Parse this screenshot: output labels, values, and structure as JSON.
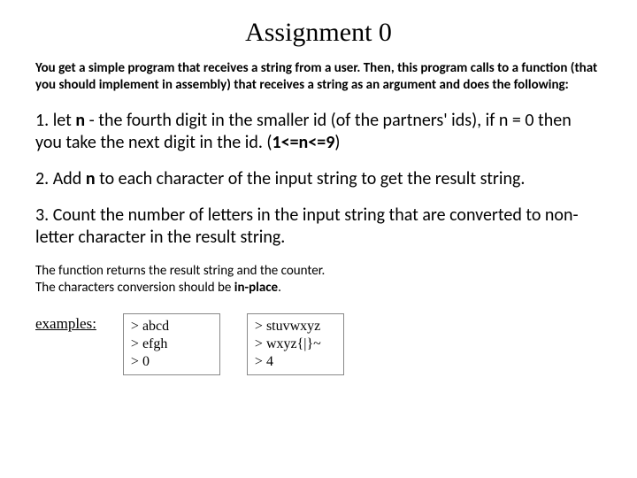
{
  "title": "Assignment 0",
  "intro": "You get a simple program that receives a string from a user. Then, this program calls to a function (that you should implement in assembly) that receives a string as an argument and does the following:",
  "step1_pre": "1. let ",
  "step1_n": "n",
  "step1_mid": " - the fourth digit in the smaller id (of the partners' ids), if n = 0 then you take the next digit in the id. (",
  "step1_range": "1<=n<=9",
  "step1_post": ")",
  "step2_pre": "2. Add ",
  "step2_n": "n",
  "step2_post": " to each character of the input string to get the result string.",
  "step3": "3. Count the number of letters in the input string that are converted to non-letter character in the result string.",
  "foot_line1": "The function returns the result string and the counter.",
  "foot_line2_pre": "The characters conversion should be ",
  "foot_line2_bold": "in-place",
  "foot_line2_post": ".",
  "examples_label": "examples:",
  "example1": {
    "l1": "> abcd",
    "l2": "> efgh",
    "l3": "> 0"
  },
  "example2": {
    "l1": "> stuvwxyz",
    "l2": "> wxyz{|}~",
    "l3": "> 4"
  }
}
